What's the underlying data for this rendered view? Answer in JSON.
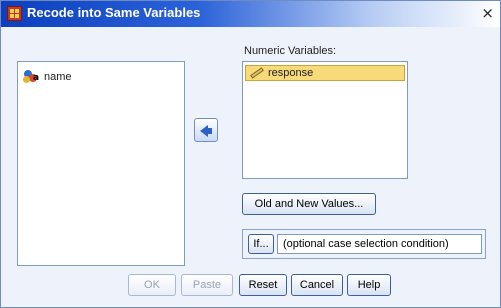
{
  "window": {
    "title": "Recode into Same Variables",
    "close_glyph": "×"
  },
  "source_list": {
    "items": [
      {
        "label": "name",
        "icon": "nominal-variable-icon"
      }
    ]
  },
  "move_button": {
    "icon": "arrow-left-icon"
  },
  "target": {
    "label": "Numeric Variables:",
    "items": [
      {
        "label": "response",
        "icon": "scale-variable-icon",
        "selected": true
      }
    ]
  },
  "buttons": {
    "old_new": "Old and New Values...",
    "if": "If...",
    "ok": "OK",
    "paste": "Paste",
    "reset": "Reset",
    "cancel": "Cancel",
    "help": "Help"
  },
  "condition": {
    "text": "(optional case selection condition)"
  },
  "colors": {
    "title_bar": "#0b3fbf",
    "selected_item": "#f7da7a",
    "dialog_bg": "#eef2fa"
  }
}
